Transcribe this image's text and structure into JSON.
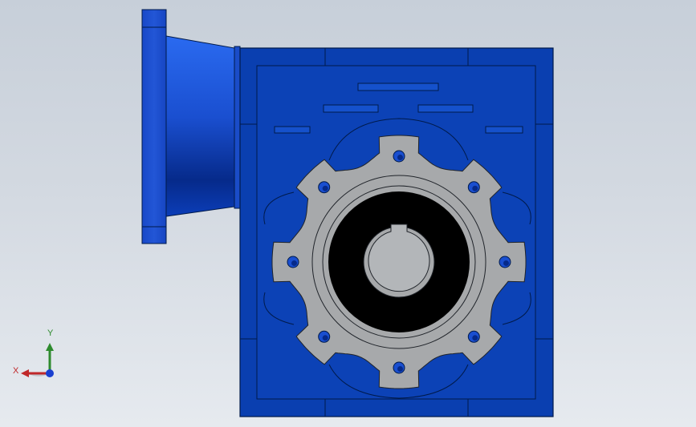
{
  "viewport": {
    "background_top": "#c7cfd9",
    "background_bottom": "#e6eaef"
  },
  "model": {
    "part": "worm-gear-reducer",
    "view": "front",
    "housing_color": "#0a3fb0",
    "housing_dark": "#002a86",
    "flange_color": "#1a4fd0",
    "face_color": "#a7a9ab",
    "bore_color": "#000000",
    "shaft_color": "#b3b6b9",
    "edge_color": "#001a4a"
  },
  "triad": {
    "x_label": "X",
    "y_label": "Y",
    "x_color": "#c0282a",
    "y_color": "#2e8b2e",
    "z_color": "#1a3fd0"
  }
}
